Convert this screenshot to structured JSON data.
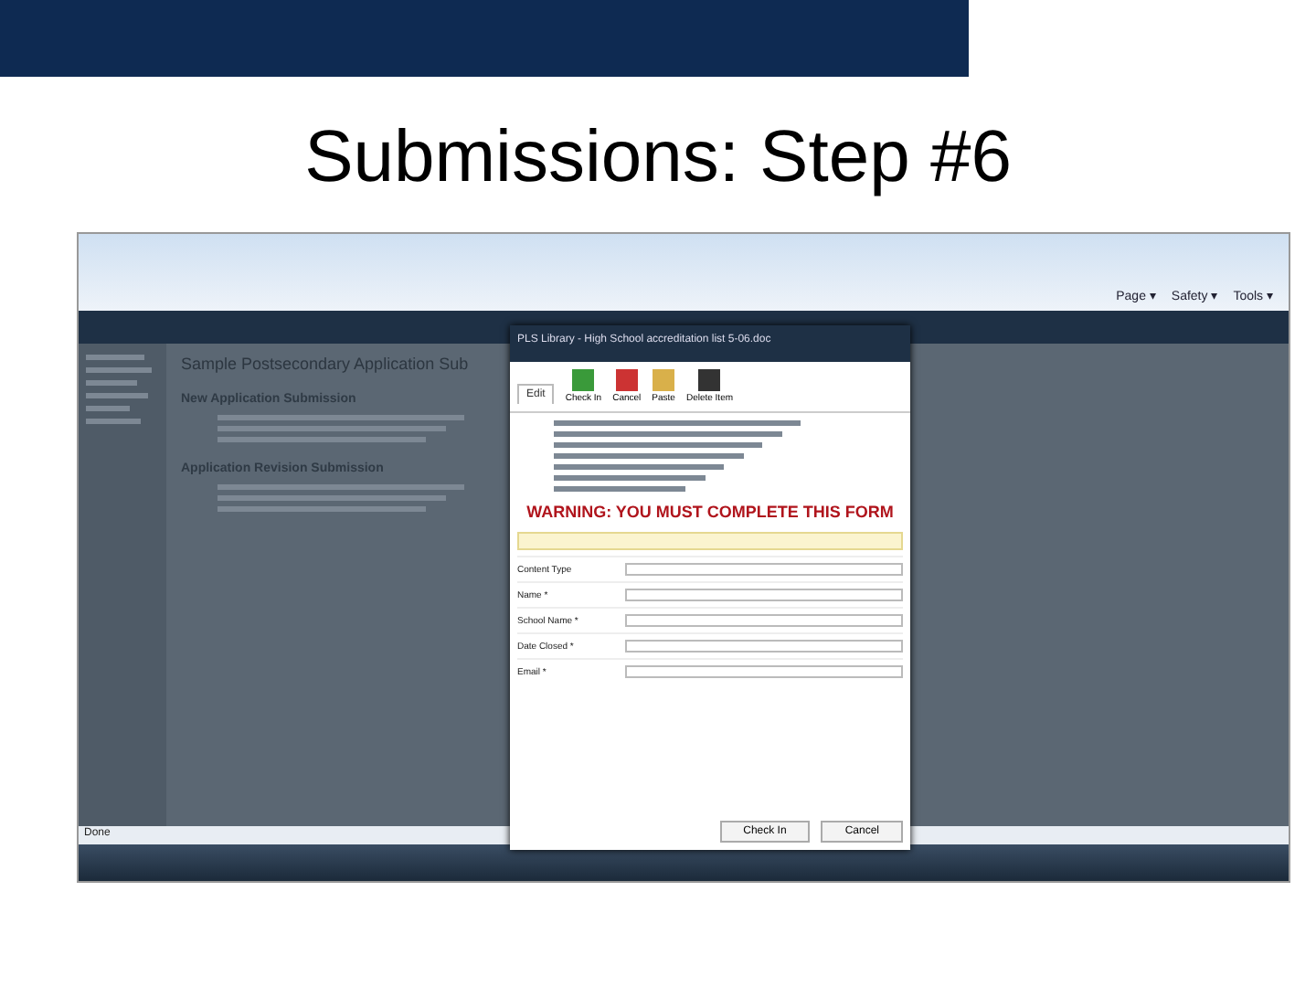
{
  "slide_title": "Submissions: Step #6",
  "browser": {
    "menu": [
      "Page ▾",
      "Safety ▾",
      "Tools ▾"
    ],
    "status": "Done"
  },
  "page": {
    "heading": "Sample Postsecondary Application Sub",
    "bullets": [
      "New Application Submission",
      "Application Revision Submission"
    ]
  },
  "dialog": {
    "title": "PLS Library - High School accreditation list 5-06.doc",
    "tab": "Edit",
    "ribbon": [
      "Check In",
      "Cancel",
      "Paste",
      "Delete Item"
    ],
    "warning": "WARNING: YOU MUST COMPLETE THIS FORM",
    "fields": [
      {
        "label": "Content Type"
      },
      {
        "label": "Name *"
      },
      {
        "label": "School Name *"
      },
      {
        "label": "Date Closed *"
      },
      {
        "label": "Email *"
      }
    ],
    "buttons": [
      "Check In",
      "Cancel"
    ]
  }
}
